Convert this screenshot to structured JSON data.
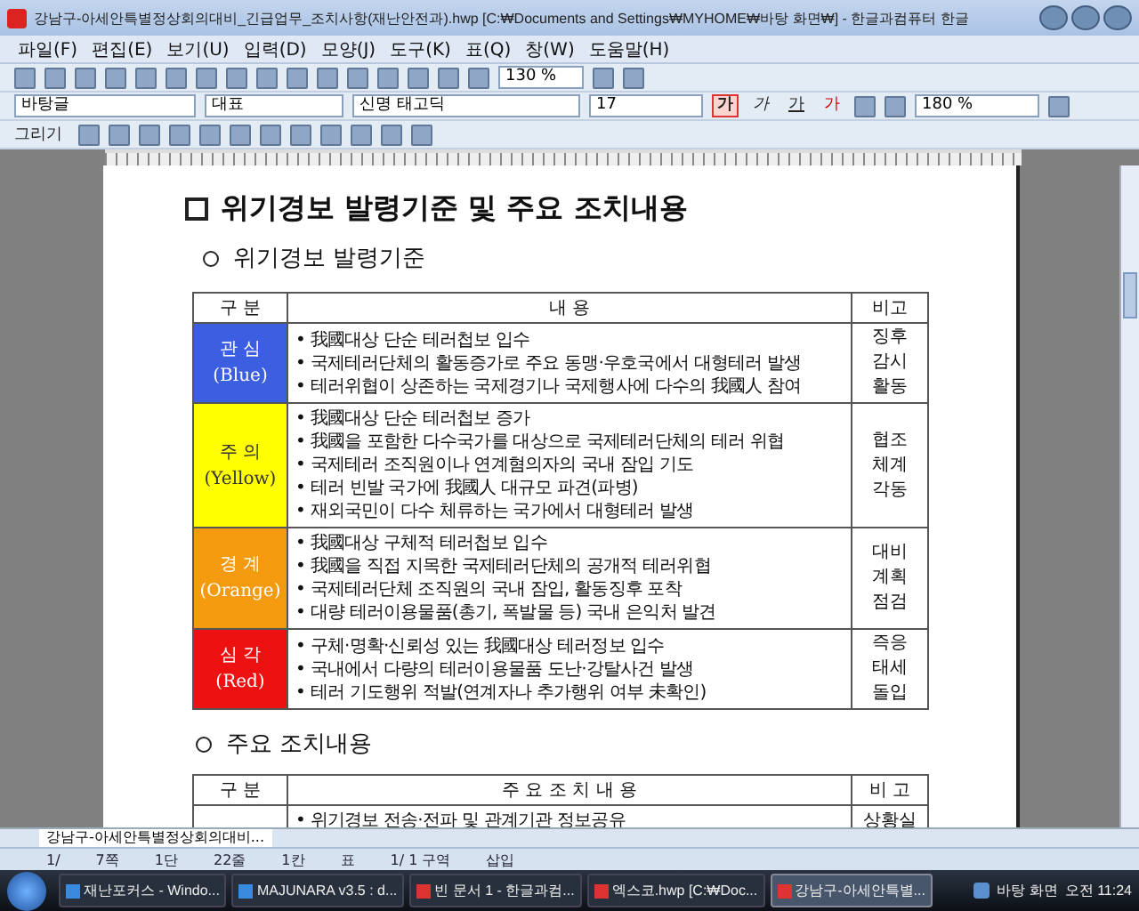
{
  "window": {
    "title": "강남구-아세안특별정상회의대비_긴급업무_조치사항(재난안전과).hwp [C:₩Documents and Settings₩MYHOME₩바탕 화면₩] - 한글과컴퓨터 한글"
  },
  "menu": [
    "파일(F)",
    "편집(E)",
    "보기(U)",
    "입력(D)",
    "모양(J)",
    "도구(K)",
    "표(Q)",
    "창(W)",
    "도움말(H)"
  ],
  "toolbar": {
    "zoom": "130 %"
  },
  "format_bar": {
    "style": "바탕글",
    "language": "대표",
    "font": "신명 태고딕",
    "size": "17",
    "line_spacing": "180 %",
    "char_buttons": [
      {
        "label": "가",
        "kind": "bold",
        "selected": true
      },
      {
        "label": "가",
        "kind": "italic",
        "selected": false
      },
      {
        "label": "가",
        "kind": "underline",
        "selected": false
      },
      {
        "label": "가",
        "kind": "color",
        "selected": false
      }
    ]
  },
  "draw_bar": {
    "label": "그리기"
  },
  "document": {
    "heading": "위기경보 발령기준 및 주요 조치내용",
    "section_1": {
      "title": "위기경보 발령기준",
      "columns": [
        "구 분",
        "내          용",
        "비고"
      ],
      "rows": [
        {
          "level": "관 심",
          "english": "(Blue)",
          "color": "#3b5fe0",
          "items": [
            "• 我國대상 단순 테러첩보 입수",
            "• 국제테러단체의 활동증가로 주요 동맹·우호국에서 대형테러 발생",
            "• 테러위협이 상존하는 국제경기나 국제행사에 다수의 我國人 참여"
          ],
          "remark": [
            "징후",
            "감시",
            "활동"
          ]
        },
        {
          "level": "주 의",
          "english": "(Yellow)",
          "color": "#ffff00",
          "items": [
            "• 我國대상 단순 테러첩보 증가",
            "• 我國을 포함한 다수국가를 대상으로 국제테러단체의 테러 위협",
            "• 국제테러 조직원이나 연계혐의자의 국내 잠입 기도",
            "• 테러 빈발 국가에 我國人 대규모 파견(파병)",
            "• 재외국민이 다수 체류하는 국가에서 대형테러 발생"
          ],
          "remark": [
            "협조",
            "체계",
            "각동"
          ]
        },
        {
          "level": "경 계",
          "english": "(Orange)",
          "color": "#f39a0e",
          "items": [
            "• 我國대상 구체적 테러첩보 입수",
            "• 我國을 직접 지목한 국제테러단체의 공개적 테러위협",
            "• 국제테러단체 조직원의 국내 잠입, 활동징후 포착",
            "• 대량 테러이용물품(총기, 폭발물 등) 국내 은익처 발견"
          ],
          "remark": [
            "대비",
            "계획",
            "점검"
          ]
        },
        {
          "level": "심 각",
          "english": "(Red)",
          "color": "#ee1111",
          "items": [
            "• 구체·명확·신뢰성 있는 我國대상 테러정보 입수",
            "• 국내에서 다량의 테러이용물품 도난·강탈사건 발생",
            "• 테러 기도행위 적발(연계자나 추가행위 여부 未확인)"
          ],
          "remark": [
            "즉응",
            "태세",
            "돌입"
          ]
        }
      ]
    },
    "section_2": {
      "title": "주요 조치내용",
      "columns": [
        "구 분",
        "주 요 조 치 내 용",
        "비 고"
      ],
      "rows": [
        {
          "item": "• 위기경보 전송·전파 및 관계기관 정보공유",
          "remark": "상황실"
        }
      ]
    }
  },
  "doc_tab": {
    "label": "강남구-아세안특별정상회의대비..."
  },
  "status_bar": [
    "1/",
    "7쪽",
    "1단",
    "22줄",
    "1칸",
    "표",
    "1/ 1 구역",
    "삽입"
  ],
  "taskbar": {
    "items": [
      {
        "label": "재난포커스 - Windo...",
        "kind": "browser",
        "selected": false
      },
      {
        "label": "MAJUNARA v3.5 : d...",
        "kind": "browser",
        "selected": false
      },
      {
        "label": "빈 문서 1 - 한글과컴...",
        "kind": "hwp",
        "selected": false
      },
      {
        "label": "엑스코.hwp [C:₩Doc...",
        "kind": "hwp",
        "selected": false
      },
      {
        "label": "강남구-아세안특별...",
        "kind": "hwp",
        "selected": true
      }
    ],
    "desktop": "바탕 화면",
    "clock": "오전 11:24"
  }
}
